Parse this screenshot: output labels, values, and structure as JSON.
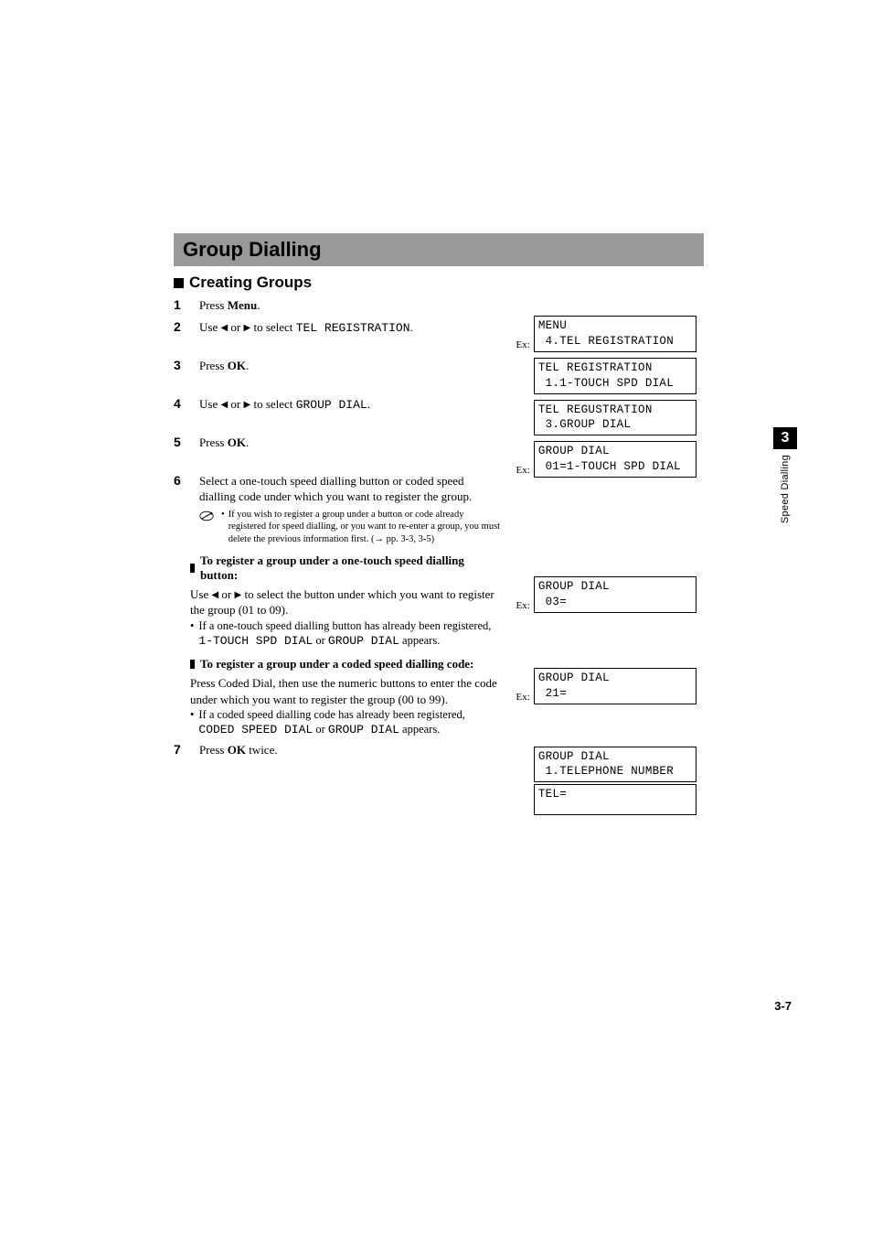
{
  "title": "Group Dialling",
  "subhead": "Creating Groups",
  "steps": {
    "s1": {
      "num": "1",
      "pre": "Press ",
      "bold": "Menu",
      "post": "."
    },
    "s2": {
      "num": "2",
      "pre": "Use ",
      "mid": " or ",
      "post2": " to select ",
      "mono": "TEL REGISTRATION",
      "end": "."
    },
    "s3": {
      "num": "3",
      "pre": "Press ",
      "bold": "OK",
      "post": "."
    },
    "s4": {
      "num": "4",
      "pre": "Use ",
      "mid": " or ",
      "post2": " to select ",
      "mono": "GROUP DIAL",
      "end": "."
    },
    "s5": {
      "num": "5",
      "pre": "Press ",
      "bold": "OK",
      "post": "."
    },
    "s6": {
      "num": "6",
      "text": "Select a one-touch speed dialling button or coded speed dialling code under which you want to register the group.",
      "note": "If you wish to register a group under a button or code already registered for speed dialling, or you want to re-enter a group, you must delete the previous information first. (→ pp. 3-3, 3-5)"
    },
    "s7": {
      "num": "7",
      "pre": "Press ",
      "bold": "OK",
      "post": " twice."
    }
  },
  "sub_one_touch": {
    "heading": "To register a group under a one-touch speed dialling button:",
    "body_pre": "Use ",
    "body_mid": " or ",
    "body_post": " to select the button under which you want to register the group (01 to 09).",
    "bullet_pre": "If a one-touch speed dialling button has already been registered, ",
    "mono1": "1-TOUCH SPD DIAL",
    "bullet_mid": " or ",
    "mono2": "GROUP DIAL",
    "bullet_end": " appears."
  },
  "sub_coded": {
    "heading": "To register a group under a coded speed dialling code:",
    "body_pre": "Press ",
    "body_bold": "Coded Dial",
    "body_post": ", then use the numeric buttons to enter the code under which you want to register the group (00 to 99).",
    "bullet_pre": "If a coded speed dialling code has already been registered, ",
    "mono1": "CODED SPEED DIAL",
    "bullet_mid": " or ",
    "mono2": "GROUP DIAL",
    "bullet_end": " appears."
  },
  "displays": {
    "ex": "Ex:",
    "d1": "MENU\n 4.TEL REGISTRATION",
    "d2": "TEL REGISTRATION\n 1.1-TOUCH SPD DIAL",
    "d3": "TEL REGUSTRATION\n 3.GROUP DIAL",
    "d4": "GROUP DIAL\n 01=1-TOUCH SPD DIAL",
    "d5": "GROUP DIAL\n 03=",
    "d6": "GROUP DIAL\n 21=",
    "d7": "GROUP DIAL\n 1.TELEPHONE NUMBER",
    "d8": "TEL="
  },
  "tab": {
    "num": "3",
    "label": "Speed Dialling"
  },
  "page_num": "3-7",
  "icons": {
    "left": "◀",
    "right": "▶"
  }
}
